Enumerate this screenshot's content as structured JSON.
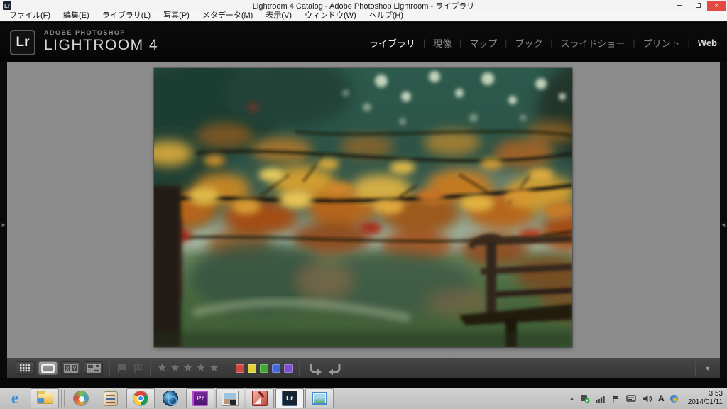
{
  "window": {
    "title": "Lightroom 4 Catalog - Adobe Photoshop Lightroom - ライブラリ",
    "app_icon_glyph": "Lr",
    "close_glyph": "×"
  },
  "menubar": {
    "items": [
      "ファイル(F)",
      "編集(E)",
      "ライブラリ(L)",
      "写真(P)",
      "メタデータ(M)",
      "表示(V)",
      "ウィンドウ(W)",
      "ヘルプ(H)"
    ]
  },
  "header": {
    "logo": "Lr",
    "brand_top": "ADOBE PHOTOSHOP",
    "brand_bottom": "LIGHTROOM 4",
    "separator": "|",
    "modules": [
      {
        "label": "ライブラリ",
        "active": true
      },
      {
        "label": "現像",
        "active": false
      },
      {
        "label": "マップ",
        "active": false
      },
      {
        "label": "ブック",
        "active": false
      },
      {
        "label": "スライドショー",
        "active": false
      },
      {
        "label": "プリント",
        "active": false
      },
      {
        "label": "Web",
        "active": false
      }
    ]
  },
  "photo": {
    "description": "Autumn maple branches with orange and yellow leaves over a blurred green garden, lawn and wooden bench"
  },
  "panels": {
    "left_arrow": "►",
    "right_arrow": "◄"
  },
  "toolbar": {
    "compare_x": "X",
    "compare_y": "Y",
    "stars": "★★★★★",
    "color_labels": [
      "#cf4740",
      "#e0d23e",
      "#43a636",
      "#4468dd",
      "#7a4fd0"
    ],
    "dropdown_glyph": "▼"
  },
  "taskbar": {
    "ie_glyph": "e",
    "premiere_glyph": "Pr",
    "lightroom_glyph": "Lr"
  },
  "tray": {
    "hidden_glyph": "▲",
    "ime": "A",
    "time": "3:53",
    "date": "2014/01/11"
  }
}
